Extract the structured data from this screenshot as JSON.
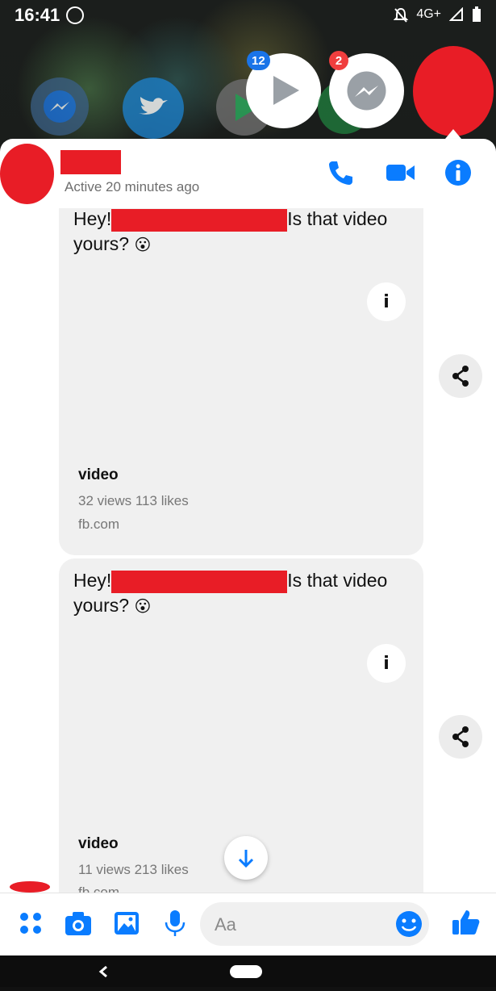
{
  "status_bar": {
    "time": "16:41",
    "network": "4G+"
  },
  "chat_heads": {
    "badges": [
      "12",
      "2"
    ]
  },
  "header": {
    "status": "Active 20 minutes ago",
    "icons": [
      "phone-icon",
      "video-call-icon",
      "info-icon"
    ]
  },
  "messages": [
    {
      "greeting": "Hey!",
      "question": "Is that video",
      "question_2": "yours?",
      "emoji": "😮",
      "video_title": "video",
      "stats": "32 views 113 likes",
      "source": "fb.com"
    },
    {
      "greeting": "Hey!",
      "question": "Is that video",
      "question_2": "yours?",
      "emoji": "😮",
      "video_title": "video",
      "stats": "11 views 213 likes",
      "source": "fb.com"
    }
  ],
  "composer": {
    "placeholder": "Aa",
    "icons": [
      "menu-dots-icon",
      "camera-icon",
      "gallery-icon",
      "microphone-icon",
      "emoji-icon",
      "thumbs-up-icon"
    ]
  },
  "colors": {
    "accent": "#0a7cff",
    "redaction": "#e81d26"
  }
}
